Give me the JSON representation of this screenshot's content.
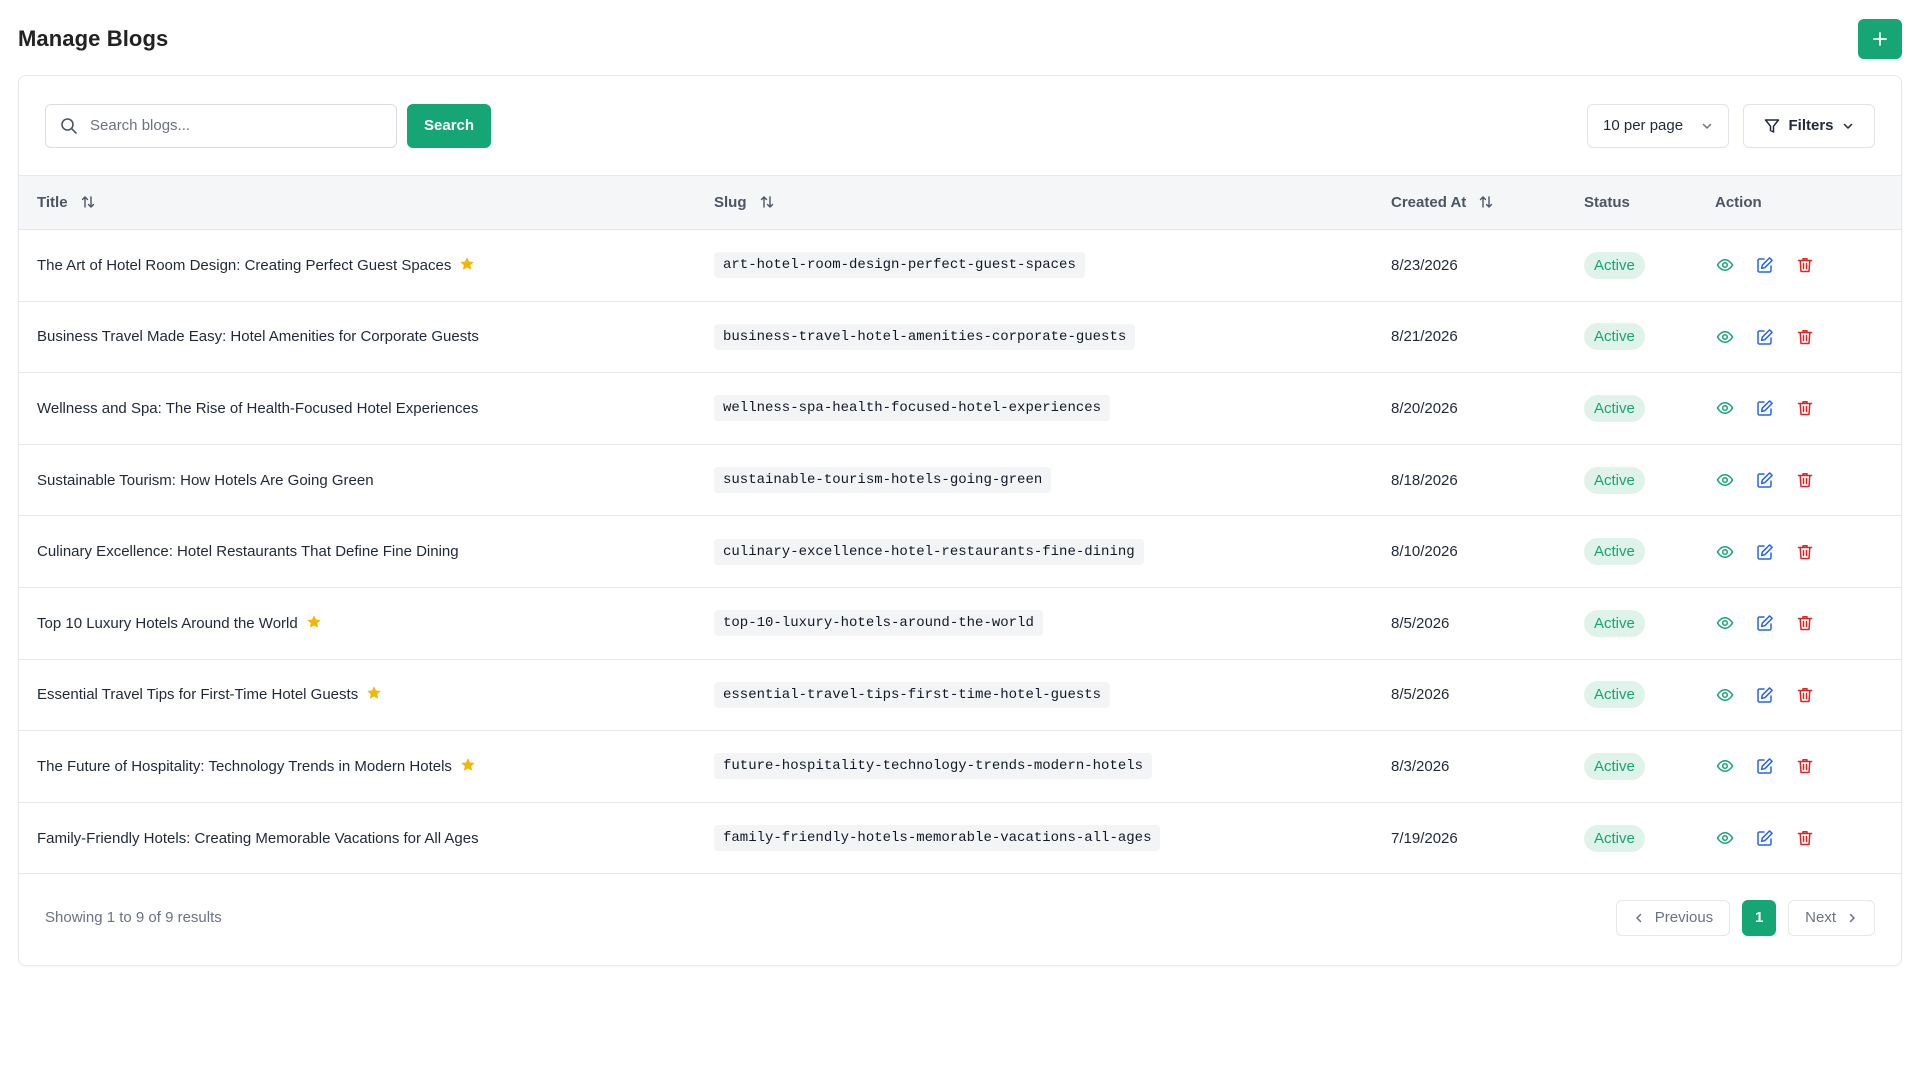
{
  "page": {
    "title": "Manage Blogs",
    "add_button_icon": "plus-icon"
  },
  "toolbar": {
    "search_placeholder": "Search blogs...",
    "search_value": "",
    "search_button": "Search",
    "per_page": "10 per page",
    "filters_label": "Filters"
  },
  "table": {
    "columns": {
      "title": "Title",
      "slug": "Slug",
      "created_at": "Created At",
      "status": "Status",
      "action": "Action"
    },
    "rows": [
      {
        "title": "The Art of Hotel Room Design: Creating Perfect Guest Spaces",
        "featured": true,
        "slug": "art-hotel-room-design-perfect-guest-spaces",
        "created_at": "8/23/2026",
        "status": "Active"
      },
      {
        "title": "Business Travel Made Easy: Hotel Amenities for Corporate Guests",
        "featured": false,
        "slug": "business-travel-hotel-amenities-corporate-guests",
        "created_at": "8/21/2026",
        "status": "Active"
      },
      {
        "title": "Wellness and Spa: The Rise of Health-Focused Hotel Experiences",
        "featured": false,
        "slug": "wellness-spa-health-focused-hotel-experiences",
        "created_at": "8/20/2026",
        "status": "Active"
      },
      {
        "title": "Sustainable Tourism: How Hotels Are Going Green",
        "featured": false,
        "slug": "sustainable-tourism-hotels-going-green",
        "created_at": "8/18/2026",
        "status": "Active"
      },
      {
        "title": "Culinary Excellence: Hotel Restaurants That Define Fine Dining",
        "featured": false,
        "slug": "culinary-excellence-hotel-restaurants-fine-dining",
        "created_at": "8/10/2026",
        "status": "Active"
      },
      {
        "title": "Top 10 Luxury Hotels Around the World",
        "featured": true,
        "slug": "top-10-luxury-hotels-around-the-world",
        "created_at": "8/5/2026",
        "status": "Active"
      },
      {
        "title": "Essential Travel Tips for First-Time Hotel Guests",
        "featured": true,
        "slug": "essential-travel-tips-first-time-hotel-guests",
        "created_at": "8/5/2026",
        "status": "Active"
      },
      {
        "title": "The Future of Hospitality: Technology Trends in Modern Hotels",
        "featured": true,
        "slug": "future-hospitality-technology-trends-modern-hotels",
        "created_at": "8/3/2026",
        "status": "Active"
      },
      {
        "title": "Family-Friendly Hotels: Creating Memorable Vacations for All Ages",
        "featured": false,
        "slug": "family-friendly-hotels-memorable-vacations-all-ages",
        "created_at": "7/19/2026",
        "status": "Active"
      }
    ]
  },
  "footer": {
    "showing": "Showing 1 to 9 of 9 results",
    "previous": "Previous",
    "current_page": "1",
    "next": "Next"
  },
  "colors": {
    "accent": "#16a574",
    "star": "#f2b705",
    "view": "#16a574",
    "edit": "#2563eb",
    "delete": "#dc2626",
    "badge_bg": "#dff3ea"
  },
  "icons": [
    "plus-icon",
    "search-icon",
    "chevron-down-icon",
    "filter-icon",
    "sort-icon",
    "star-icon",
    "eye-icon",
    "edit-icon",
    "trash-icon",
    "chevron-left-icon",
    "chevron-right-icon"
  ]
}
